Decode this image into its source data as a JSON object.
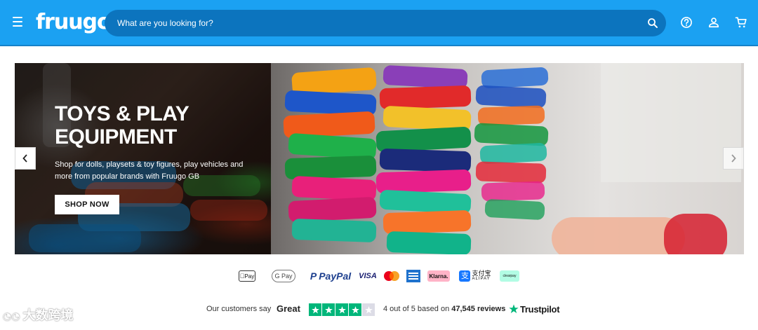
{
  "header": {
    "logo_text": "fruugo",
    "search_placeholder": "What are you looking for?",
    "icons": [
      "menu-icon",
      "search-icon",
      "help-icon",
      "account-icon",
      "cart-icon"
    ],
    "brand_color": "#1ba1f2"
  },
  "banner": {
    "title": "TOYS & PLAY EQUIPMENT",
    "description": "Shop for dolls, playsets & toy figures, play vehicles and more from popular brands with Fruugo GB",
    "cta_label": "SHOP NOW",
    "icons": [
      "chevron-left-icon",
      "chevron-right-icon"
    ]
  },
  "payments": {
    "apple_pay": "Pay",
    "google_pay": "G Pay",
    "paypal": "PayPal",
    "visa": "VISA",
    "klarna": "Klarna.",
    "alipay_cn": "支付宝",
    "alipay_en": "ALIPAY",
    "clearpay": "clearpay"
  },
  "trustpilot": {
    "intro": "Our customers say",
    "rating_word": "Great",
    "stars_filled": 4,
    "stars_total": 5,
    "rating_prefix": "4 out of 5 based on",
    "review_count": "47,545",
    "review_suffix": "reviews",
    "brand": "Trustpilot",
    "star_color": "#00b67a"
  },
  "watermark": "大数跨境"
}
